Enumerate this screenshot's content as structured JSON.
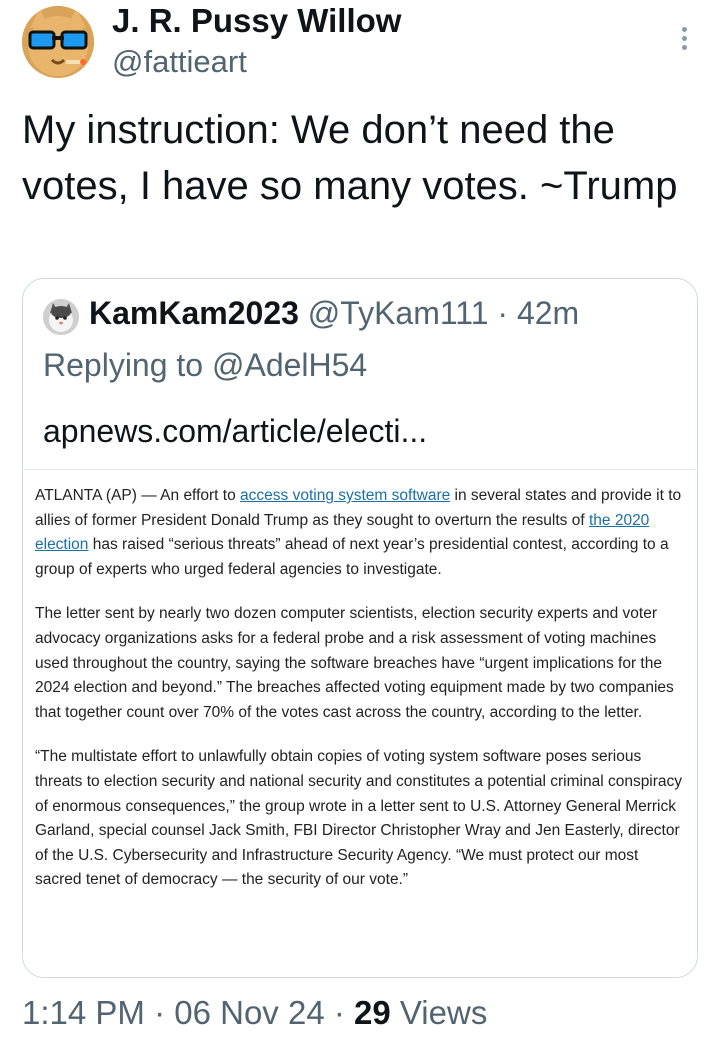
{
  "author": {
    "display_name": "J. R. Pussy Willow",
    "handle": "@fattieart"
  },
  "tweet": {
    "text": "My instruction: We don’t need the votes, I have so many votes. ~Trump"
  },
  "quote": {
    "name": "KamKam2023",
    "handle": "@TyKam111",
    "separator": " · ",
    "time": "42m",
    "replying_prefix": "Replying to ",
    "replying_to": "@AdelH54",
    "link_text": "apnews.com/article/electi..."
  },
  "article": {
    "p1_a": "ATLANTA (AP) — An effort to ",
    "p1_link1": "access voting system software",
    "p1_b": " in several states and provide it to allies of former President Donald Trump as they sought to overturn the results of ",
    "p1_link2": "the 2020 election",
    "p1_c": " has raised “serious threats” ahead of next year’s presidential contest, according to a group of experts who urged federal agencies to investigate.",
    "p2": "The letter sent by nearly two dozen computer scientists, election security experts and voter advocacy organizations asks for a federal probe and a risk assessment of voting machines used throughout the country, saying the software breaches have “urgent implications for the 2024 election and beyond.” The breaches affected voting equipment made by two companies that together count over 70% of the votes cast across the country, according to the letter.",
    "p3": "“The multistate effort to unlawfully obtain copies of voting system software poses serious threats to election security and national security and constitutes a potential criminal conspiracy of enormous consequences,” the group wrote in a letter sent to U.S. Attorney General Merrick Garland, special counsel Jack Smith, FBI Director Christopher Wray and Jen Easterly, director of the U.S. Cybersecurity and Infrastructure Security Agency. “We must protect our most sacred tenet of democracy — the security of our vote.”"
  },
  "footer": {
    "time": "1:14 PM",
    "sep1": " · ",
    "date": "06 Nov 24",
    "sep2": " · ",
    "views_count": "29",
    "views_label": " Views"
  },
  "icons": {
    "more": "more-vertical-icon"
  },
  "colors": {
    "text_primary": "#0f1419",
    "text_secondary": "#536471",
    "border": "#cfd9de",
    "article_link": "#1a6fa3"
  }
}
